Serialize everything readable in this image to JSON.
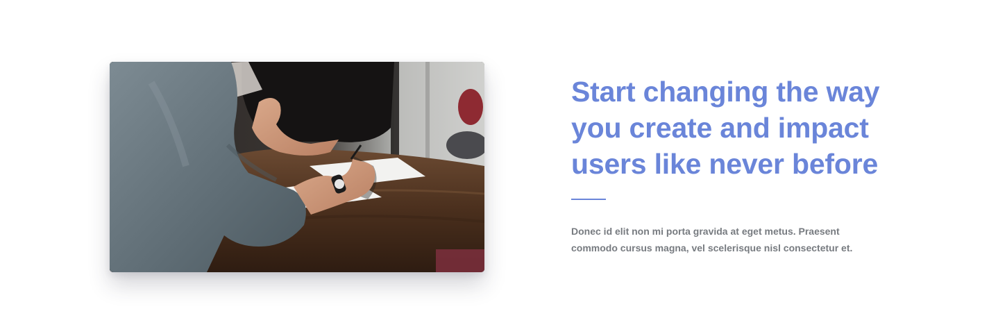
{
  "image": {
    "alt": "Two people discussing paperwork at a wooden table",
    "icon": "photo-image"
  },
  "content": {
    "headline": "Start changing the way you create and impact users like never before",
    "body": "Donec id elit non mi porta gravida at eget metus. Praesent commodo cursus magna, vel scelerisque nisl consectetur et."
  },
  "colors": {
    "accent": "#6a85d9",
    "body_text": "#777b80",
    "background": "#ffffff"
  }
}
